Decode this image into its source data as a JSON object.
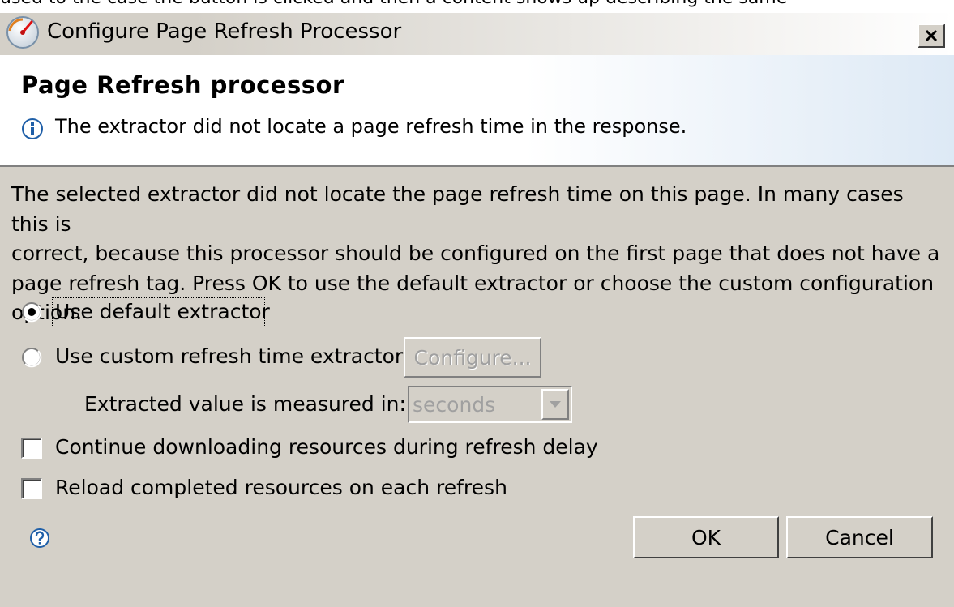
{
  "background_text": "used to the case the button is clicked and then a content shows up describing the same",
  "window": {
    "title": "Configure Page Refresh Processor",
    "icon": "app-gauge-icon",
    "close_icon": "close-icon"
  },
  "header": {
    "title": "Page Refresh processor",
    "info_icon": "info-icon",
    "message": "The extractor did not locate a page refresh time in the response."
  },
  "body": {
    "description_lines": [
      "The selected extractor did not locate the page refresh time on this page. In many cases this is",
      "correct, because this processor should be configured on the first page that does not have a",
      "page refresh tag. Press OK to use the default extractor or choose the custom configuration",
      "option:"
    ],
    "options": {
      "default": {
        "label": "Use default extractor",
        "selected": true
      },
      "custom": {
        "label": "Use custom refresh time extractor",
        "selected": false
      }
    },
    "configure_button": "Configure...",
    "unit_label": "Extracted value is measured in:",
    "unit_value": "seconds",
    "checkboxes": {
      "continue_downloading": {
        "label": "Continue downloading resources during refresh delay",
        "checked": false
      },
      "reload_completed": {
        "label": "Reload completed resources on each refresh",
        "checked": false
      }
    }
  },
  "footer": {
    "help_icon": "help-icon",
    "ok": "OK",
    "cancel": "Cancel"
  },
  "colors": {
    "dialog_bg": "#d4d0c8",
    "header_bg": "#ffffff",
    "disabled_text": "#a0a0a0",
    "info_blue": "#1f5fa8"
  }
}
